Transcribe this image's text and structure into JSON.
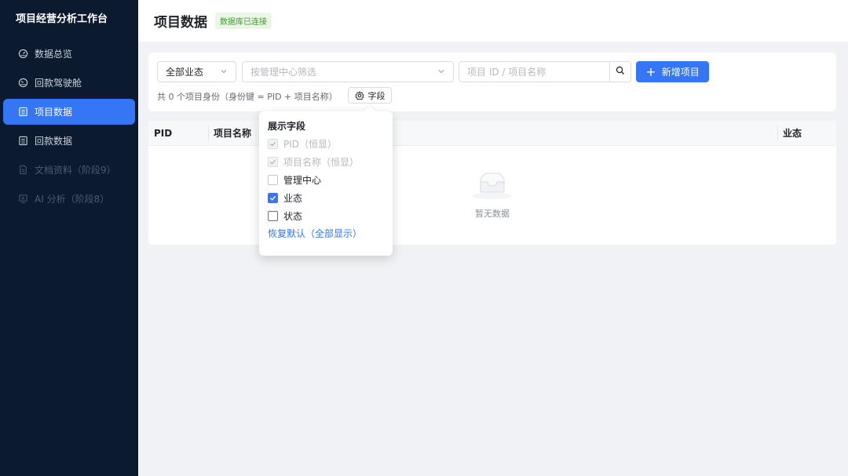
{
  "app": {
    "title": "项目经营分析工作台"
  },
  "sidebar": {
    "items": [
      {
        "label": "数据总览",
        "icon": "dashboard-icon",
        "state": "normal"
      },
      {
        "label": "回款驾驶舱",
        "icon": "gauge-icon",
        "state": "normal"
      },
      {
        "label": "项目数据",
        "icon": "list-icon",
        "state": "active"
      },
      {
        "label": "回款数据",
        "icon": "list-icon",
        "state": "normal"
      },
      {
        "label": "文档资料（阶段9）",
        "icon": "document-icon",
        "state": "disabled"
      },
      {
        "label": "AI 分析（阶段8）",
        "icon": "ai-icon",
        "state": "disabled"
      }
    ]
  },
  "header": {
    "title": "项目数据",
    "db_status": "数据库已连接"
  },
  "filters": {
    "status_select": {
      "value": "全部业态"
    },
    "center_select": {
      "placeholder": "按管理中心筛选"
    },
    "search": {
      "placeholder": "项目 ID / 项目名称"
    },
    "add_button": "新增项目",
    "count_text": "共 0 个项目身份（身份键 = PID + 项目名称）",
    "field_button": "字段"
  },
  "table": {
    "columns": [
      "PID",
      "项目名称",
      "业态"
    ],
    "empty_text": "暂无数据"
  },
  "field_popover": {
    "title": "展示字段",
    "options": [
      {
        "label": "PID（恒显）",
        "checked": true,
        "disabled": true
      },
      {
        "label": "项目名称（恒显）",
        "checked": true,
        "disabled": true
      },
      {
        "label": "管理中心",
        "checked": false,
        "disabled": false
      },
      {
        "label": "业态",
        "checked": true,
        "disabled": false
      },
      {
        "label": "状态",
        "checked": false,
        "disabled": false
      }
    ],
    "reset_label": "恢复默认（全部显示）"
  },
  "colors": {
    "accent": "#3476f5",
    "sidebar_bg": "#0b1a2e",
    "success": "#3f9a2a"
  }
}
